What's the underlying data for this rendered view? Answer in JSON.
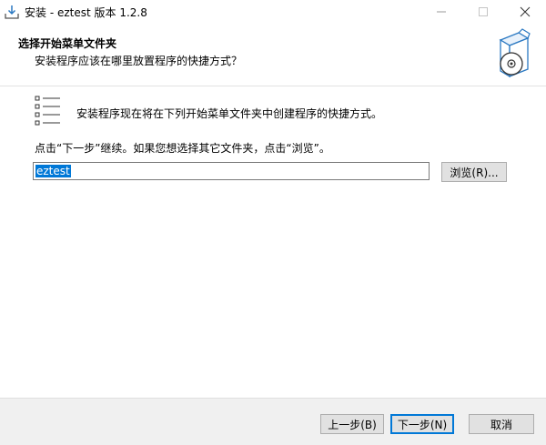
{
  "window": {
    "title": "安装 - eztest 版本 1.2.8"
  },
  "header": {
    "title": "选择开始菜单文件夹",
    "subtitle": "安装程序应该在哪里放置程序的快捷方式？"
  },
  "body": {
    "description": "安装程序现在将在下列开始菜单文件夹中创建程序的快捷方式。",
    "hint": "点击“下一步”继续。如果您想选择其它文件夹，点击“浏览”。",
    "folder_value": "eztest",
    "browse_label": "浏览(R)..."
  },
  "footer": {
    "back_label": "上一步(B)",
    "next_label": "下一步(N)",
    "cancel_label": "取消"
  },
  "colors": {
    "selection": "#0078d7",
    "accent_border": "#0078d7"
  }
}
